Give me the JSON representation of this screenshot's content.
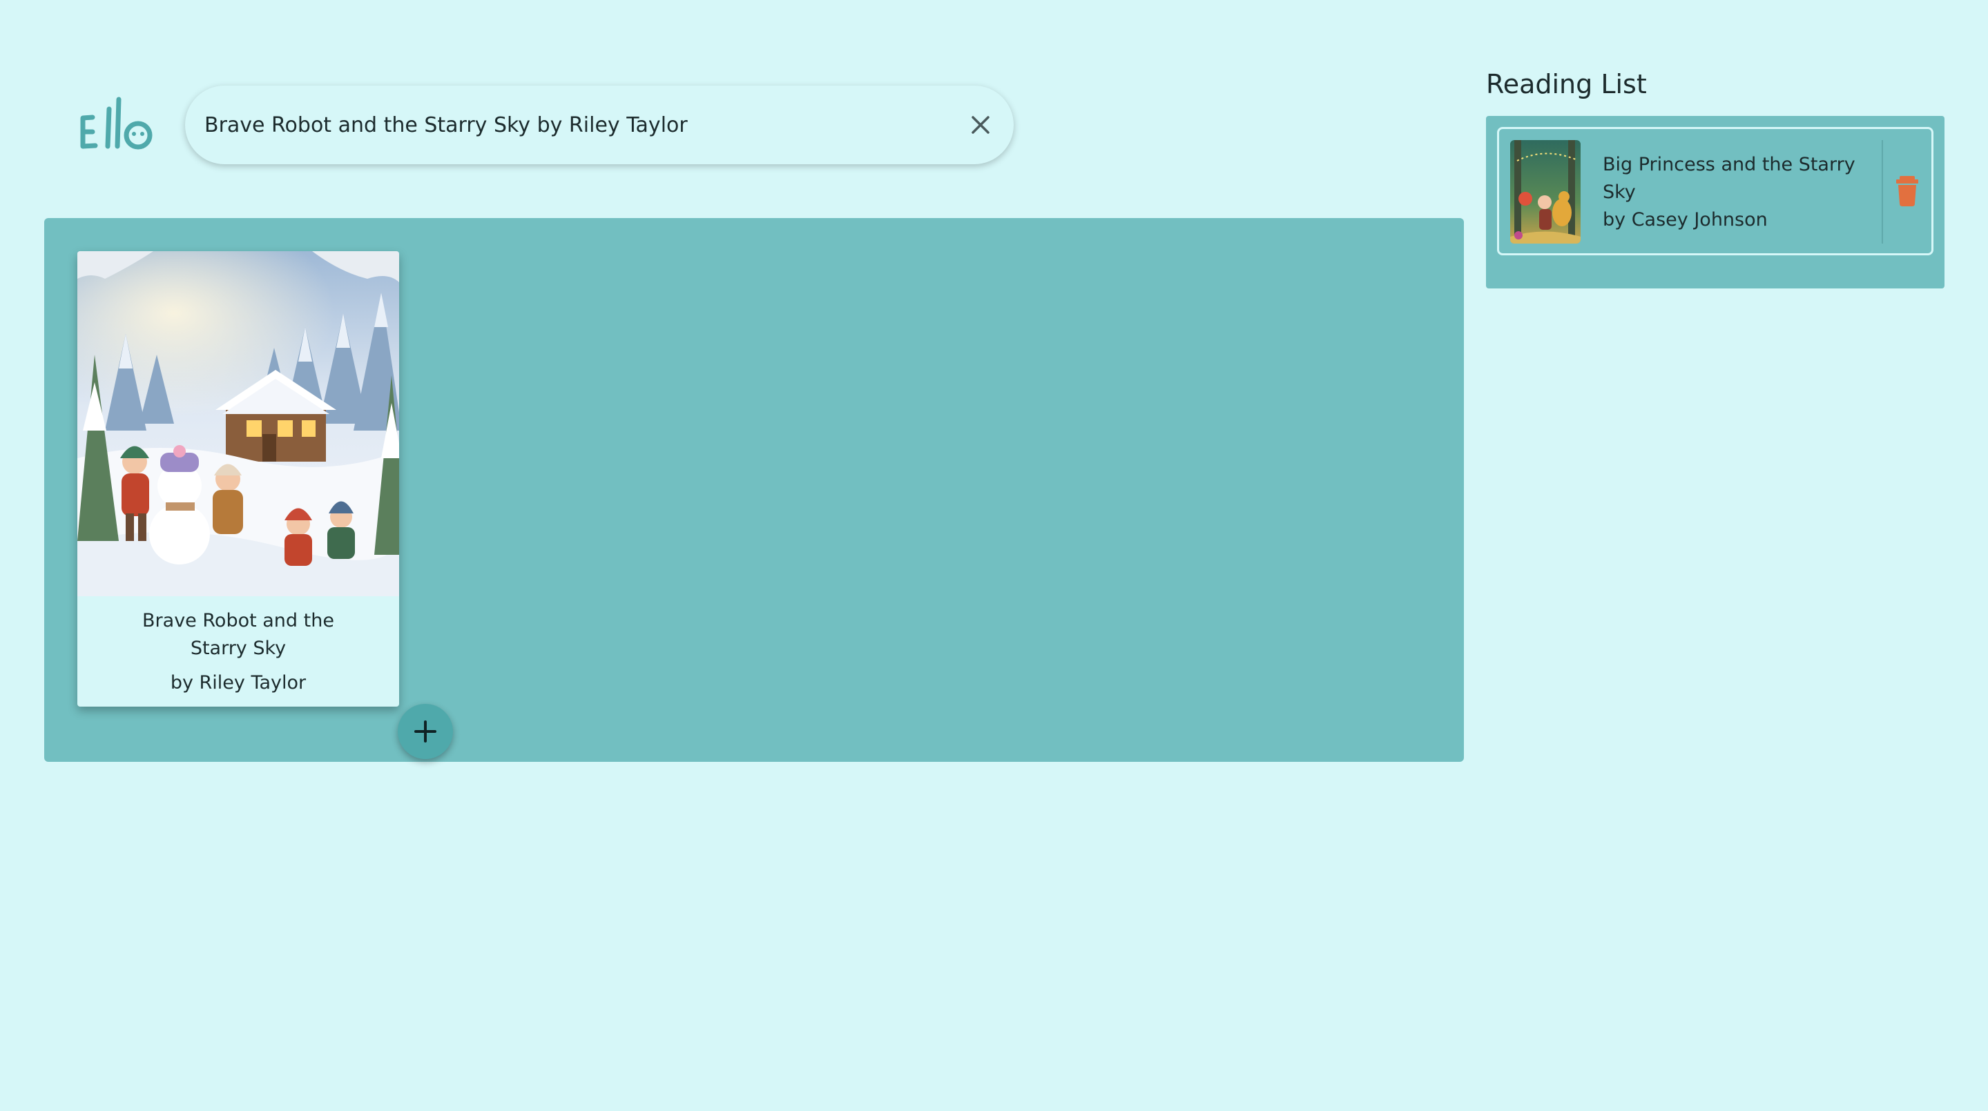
{
  "app": {
    "logo_text": "Ello"
  },
  "search": {
    "value": "Brave Robot and the Starry Sky by Riley Taylor",
    "placeholder": "",
    "clear_icon": "close-icon"
  },
  "results": [
    {
      "title": "Brave Robot and the Starry Sky",
      "author": "by Riley Taylor",
      "cover_description": "children building a snowman in front of a snowy cottage",
      "add_icon": "plus-icon"
    }
  ],
  "reading_list": {
    "heading": "Reading List",
    "items": [
      {
        "title": "Big Princess and the Starry Sky",
        "author": "by Casey Johnson",
        "delete_icon": "trash-icon"
      }
    ]
  },
  "colors": {
    "background": "#d6f7f8",
    "panel": "#72bfc1",
    "accent": "#4fa9ab",
    "delete": "#e2703f"
  }
}
